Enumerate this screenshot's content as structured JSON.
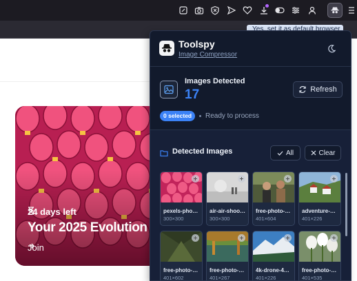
{
  "browser": {
    "tooltip": "Yes, set it as default browser",
    "toolbar_icons": [
      "edit-icon",
      "camera-icon",
      "shield-icon",
      "send-icon",
      "heart-icon",
      "download-icon",
      "toggle-icon",
      "sliders-icon",
      "user-icon"
    ]
  },
  "promo": {
    "days_left": "24 days left",
    "title": "Your 2025 Evolution",
    "join_label": "Join"
  },
  "extension": {
    "name": "Toolspy",
    "subtitle": "Image Compressor",
    "detected_label": "Images Detected",
    "detected_count": "17",
    "refresh_label": "Refresh",
    "selected_badge": "0 selected",
    "status": "Ready to process",
    "list_title": "Detected Images",
    "all_label": "All",
    "clear_label": "Clear",
    "accent_color": "#3b82f6",
    "images": [
      {
        "name": "pexels-pho…",
        "dims": "300×300",
        "thumb": "lanterns"
      },
      {
        "name": "air-air-shoo…",
        "dims": "300×300",
        "thumb": "mist"
      },
      {
        "name": "free-photo-…",
        "dims": "401×604",
        "thumb": "people"
      },
      {
        "name": "adventure-…",
        "dims": "401×226",
        "thumb": "village"
      },
      {
        "name": "free-photo-…",
        "dims": "401×602",
        "thumb": "forest"
      },
      {
        "name": "free-photo-…",
        "dims": "401×267",
        "thumb": "lake"
      },
      {
        "name": "4k-drone-4…",
        "dims": "401×226",
        "thumb": "mountain"
      },
      {
        "name": "free-photo-…",
        "dims": "401×535",
        "thumb": "tulips"
      }
    ]
  }
}
